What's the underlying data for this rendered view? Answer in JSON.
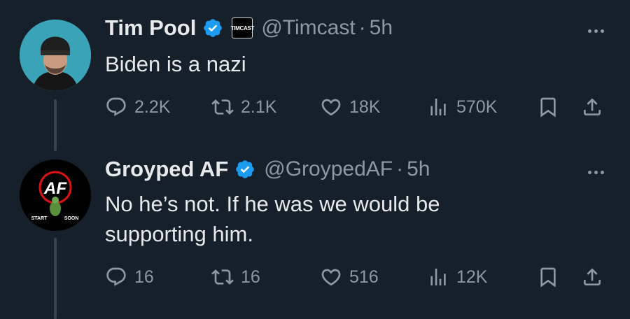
{
  "tweets": [
    {
      "name": "Tim Pool",
      "affiliation_badge": "TIMCAST",
      "handle": "@Timcast",
      "separator": "·",
      "time": "5h",
      "text": "Biden is a nazi",
      "actions": {
        "replies": "2.2K",
        "reposts": "2.1K",
        "likes": "18K",
        "views": "570K"
      },
      "verified": true
    },
    {
      "name": "Groyped AF",
      "handle": "@GroypedAF",
      "separator": "·",
      "time": "5h",
      "text_line1": "No he’s not. If he was we would be",
      "text_line2": "supporting him.",
      "avatar_text": {
        "logo": "AF",
        "left": "START",
        "right": "SOON"
      },
      "actions": {
        "replies": "16",
        "reposts": "16",
        "likes": "516",
        "views": "12K"
      },
      "verified": true
    }
  ],
  "icons": [
    "reply-icon",
    "repost-icon",
    "like-icon",
    "views-icon",
    "bookmark-icon",
    "share-icon",
    "verified-icon",
    "more-icon"
  ],
  "colors": {
    "background": "#15202b",
    "text": "#e7e9ea",
    "muted": "#8b98a5",
    "verified": "#1d9bf0"
  }
}
